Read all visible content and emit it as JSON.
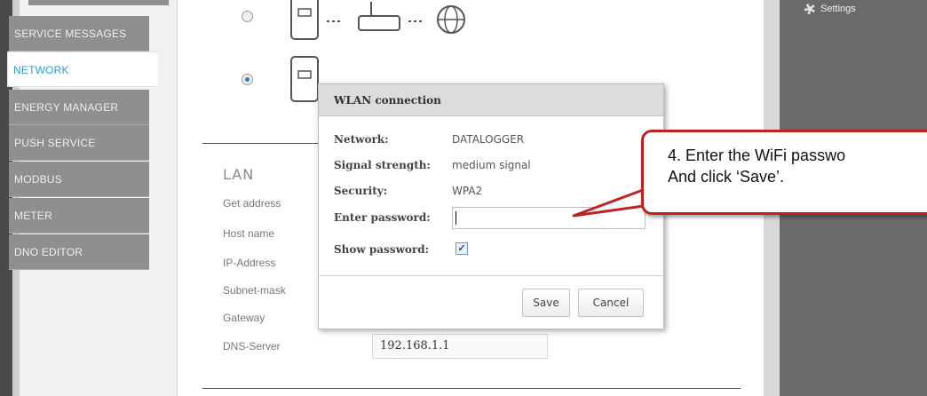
{
  "sidebar": {
    "items": [
      {
        "label": "SERVICE MESSAGES",
        "active": false
      },
      {
        "label": "NETWORK",
        "active": true
      },
      {
        "label": "ENERGY MANAGER",
        "active": false
      },
      {
        "label": "PUSH SERVICE",
        "active": false
      },
      {
        "label": "MODBUS",
        "active": false
      },
      {
        "label": "METER",
        "active": false
      },
      {
        "label": "DNO EDITOR",
        "active": false
      }
    ]
  },
  "header_right": {
    "settings_label": "Settings"
  },
  "lan": {
    "title": "LAN",
    "labels": [
      "Get address",
      "Host name",
      "IP-Address",
      "Subnet-mask",
      "Gateway",
      "DNS-Server"
    ],
    "dns_value": "192.168.1.1"
  },
  "dialog": {
    "title": "WLAN connection",
    "network_label": "Network:",
    "network_value": "DATALOGGER",
    "signal_label": "Signal strength:",
    "signal_value": "medium signal",
    "security_label": "Security:",
    "security_value": "WPA2",
    "password_label": "Enter password:",
    "password_value": "",
    "show_password_label": "Show password:",
    "show_password_checked": true,
    "save_label": "Save",
    "cancel_label": "Cancel"
  },
  "callout": {
    "line1": "4. Enter the WiFi passwo",
    "line2": "And click ‘Save’."
  },
  "colors": {
    "accent": "#2e9bd3",
    "callout_border": "#c02222",
    "sidebar_item": "#8f8f8f"
  }
}
